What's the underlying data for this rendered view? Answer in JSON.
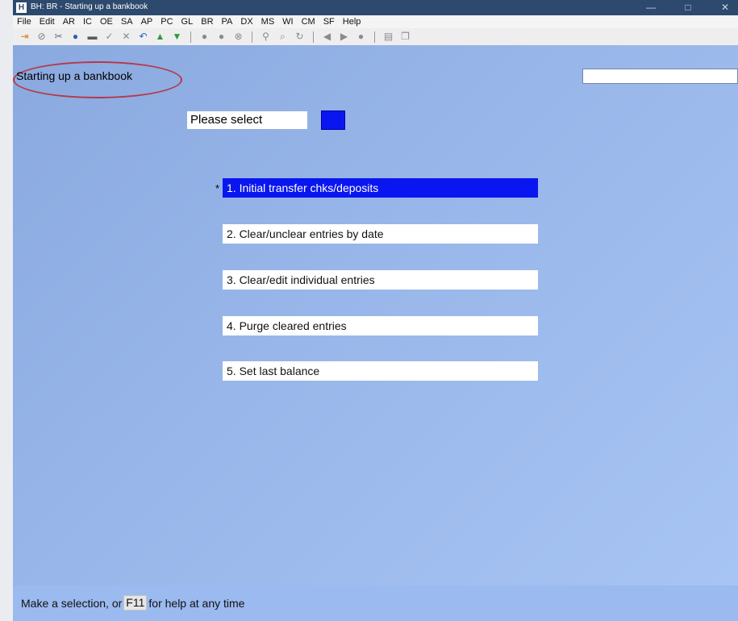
{
  "window": {
    "title": "BH: BR - Starting up a bankbook",
    "app_icon_glyph": "H",
    "minimize_glyph": "—",
    "maximize_glyph": "□",
    "close_glyph": "✕"
  },
  "menu": [
    "File",
    "Edit",
    "AR",
    "IC",
    "OE",
    "SA",
    "AP",
    "PC",
    "GL",
    "BR",
    "PA",
    "DX",
    "MS",
    "WI",
    "CM",
    "SF",
    "Help"
  ],
  "toolbar": {
    "icons": [
      {
        "name": "exit-icon",
        "glyph": "⇥",
        "color": "#e07b1a"
      },
      {
        "name": "cancel-icon",
        "glyph": "⊘",
        "color": "#7f7f7f"
      },
      {
        "name": "tools-icon",
        "glyph": "✂",
        "color": "#5b6e8c"
      },
      {
        "name": "globe-icon",
        "glyph": "●",
        "color": "#2f5fb3"
      },
      {
        "name": "print-icon",
        "glyph": "▬",
        "color": "#5a5a5a"
      },
      {
        "name": "check-icon",
        "glyph": "✓",
        "color": "#8c8c8c"
      },
      {
        "name": "delete-icon",
        "glyph": "✕",
        "color": "#8c8c8c"
      },
      {
        "name": "undo-icon",
        "glyph": "↶",
        "color": "#1e63c9"
      },
      {
        "name": "up-arrow-icon",
        "glyph": "▲",
        "color": "#2d9b3a"
      },
      {
        "name": "down-arrow-icon",
        "glyph": "▼",
        "color": "#2d9b3a"
      },
      {
        "name": "separator"
      },
      {
        "name": "circle-1-icon",
        "glyph": "●",
        "color": "#8a8a8a"
      },
      {
        "name": "circle-2-icon",
        "glyph": "●",
        "color": "#8a8a8a"
      },
      {
        "name": "circle-3-icon",
        "glyph": "⊗",
        "color": "#8a8a8a"
      },
      {
        "name": "separator"
      },
      {
        "name": "binoculars-icon",
        "glyph": "⚲",
        "color": "#8a8a8a"
      },
      {
        "name": "zoom-icon",
        "glyph": "⌕",
        "color": "#8a8a8a"
      },
      {
        "name": "refresh-icon",
        "glyph": "↻",
        "color": "#8a8a8a"
      },
      {
        "name": "separator"
      },
      {
        "name": "prev-icon",
        "glyph": "◀",
        "color": "#8a8a8a"
      },
      {
        "name": "next-icon",
        "glyph": "▶",
        "color": "#8a8a8a"
      },
      {
        "name": "globe-gray-icon",
        "glyph": "●",
        "color": "#8a8a8a"
      },
      {
        "name": "separator"
      },
      {
        "name": "document-icon",
        "glyph": "▤",
        "color": "#8a8a8a"
      },
      {
        "name": "copy-icon",
        "glyph": "❐",
        "color": "#8a8a8a"
      }
    ]
  },
  "screen": {
    "title": "Starting up a bankbook",
    "prompt": "Please select",
    "selection_value": "",
    "marker": "*",
    "options": [
      "1. Initial transfer chks/deposits",
      "2. Clear/unclear entries by date",
      "3. Clear/edit individual entries",
      "4. Purge cleared entries",
      "5. Set last balance"
    ],
    "active_option_index": 0
  },
  "status": {
    "before": "Make a selection, or",
    "key": "F11",
    "after": "for help at any time"
  },
  "colors": {
    "titlebar": "#2d4a6e",
    "selection_blue": "#0a16f0",
    "annotation_red": "#b5394a"
  }
}
